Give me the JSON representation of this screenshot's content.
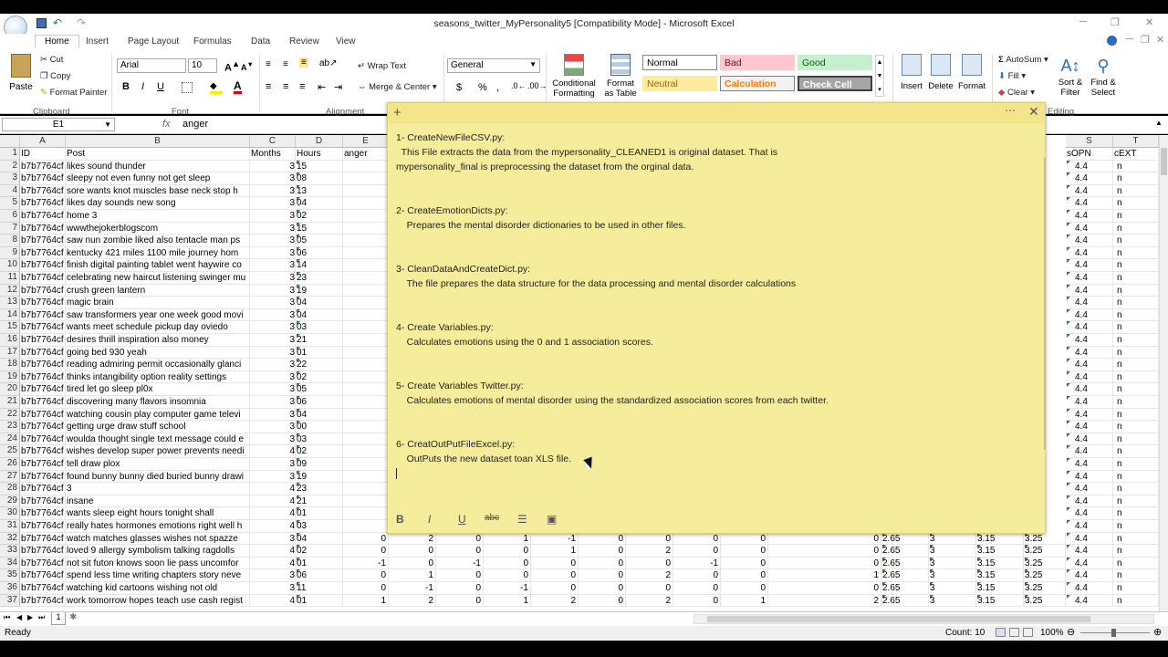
{
  "window": {
    "title": "seasons_twitter_MyPersonality5  [Compatibility Mode] - Microsoft Excel"
  },
  "ribbon_tabs": [
    "Home",
    "Insert",
    "Page Layout",
    "Formulas",
    "Data",
    "Review",
    "View"
  ],
  "ribbon": {
    "clipboard": {
      "paste": "Paste",
      "cut": "Cut",
      "copy": "Copy",
      "format_painter": "Format Painter",
      "group": "Clipboard"
    },
    "font": {
      "name": "Arial",
      "size": "10",
      "bold": "B",
      "italic": "I",
      "underline": "U",
      "group": "Font"
    },
    "alignment": {
      "wrap_text": "Wrap Text",
      "merge_center": "Merge & Center",
      "group": "Alignment"
    },
    "number": {
      "format": "General",
      "currency": "$",
      "percent": "%",
      "comma": ","
    },
    "styles": {
      "conditional": [
        "Conditional",
        "Formatting"
      ],
      "format_table": [
        "Format",
        "as Table"
      ],
      "normal": "Normal",
      "bad": "Bad",
      "good": "Good",
      "neutral": "Neutral",
      "calculation": "Calculation",
      "check_cell": "Check Cell"
    },
    "cells": {
      "insert": "Insert",
      "delete": "Delete",
      "format": "Format"
    },
    "editing": {
      "autosum": "AutoSum",
      "fill": "Fill",
      "clear": "Clear",
      "sort_filter": [
        "Sort &",
        "Filter"
      ],
      "find_select": [
        "Find &",
        "Select"
      ],
      "group": "Editing"
    }
  },
  "formula_bar": {
    "name_box": "E1",
    "fx": "fx",
    "content": "anger"
  },
  "columns": {
    "left": [
      "A",
      "B",
      "C",
      "D",
      "E"
    ],
    "right": [
      "S",
      "T"
    ]
  },
  "header_row": {
    "row": "1",
    "a": "ID",
    "b": "Post",
    "c": "Months",
    "d": "Hours",
    "e": "anger",
    "s": "sOPN",
    "t": "cEXT"
  },
  "rows": [
    {
      "n": "2",
      "a": "b7b7764cf",
      "b": "likes sound thunder",
      "c": "3",
      "d": "15",
      "s": "4.4",
      "t": "n"
    },
    {
      "n": "3",
      "a": "b7b7764cf",
      "b": "sleepy not even funny not get sleep",
      "c": "3",
      "d": "08",
      "s": "4.4",
      "t": "n"
    },
    {
      "n": "4",
      "a": "b7b7764cf",
      "b": "sore wants knot muscles base neck stop h",
      "c": "3",
      "d": "13",
      "s": "4.4",
      "t": "n"
    },
    {
      "n": "5",
      "a": "b7b7764cf",
      "b": "likes day sounds new song",
      "c": "3",
      "d": "04",
      "s": "4.4",
      "t": "n"
    },
    {
      "n": "6",
      "a": "b7b7764cf",
      "b": "home 3",
      "c": "3",
      "d": "02",
      "s": "4.4",
      "t": "n"
    },
    {
      "n": "7",
      "a": "b7b7764cf",
      "b": "wwwthejokerblogscom",
      "c": "3",
      "d": "15",
      "s": "4.4",
      "t": "n"
    },
    {
      "n": "8",
      "a": "b7b7764cf",
      "b": "saw nun zombie liked also tentacle man ps",
      "c": "3",
      "d": "05",
      "s": "4.4",
      "t": "n"
    },
    {
      "n": "9",
      "a": "b7b7764cf",
      "b": "kentucky 421 miles 1100 mile journey hom",
      "c": "3",
      "d": "06",
      "s": "4.4",
      "t": "n"
    },
    {
      "n": "10",
      "a": "b7b7764cf",
      "b": "finish digital painting tablet went haywire co",
      "c": "3",
      "d": "14",
      "s": "4.4",
      "t": "n"
    },
    {
      "n": "11",
      "a": "b7b7764cf",
      "b": "celebrating new haircut listening swinger mu",
      "c": "3",
      "d": "23",
      "s": "4.4",
      "t": "n"
    },
    {
      "n": "12",
      "a": "b7b7764cf",
      "b": "crush green lantern",
      "c": "3",
      "d": "19",
      "s": "4.4",
      "t": "n"
    },
    {
      "n": "13",
      "a": "b7b7764cf",
      "b": "magic brain",
      "c": "3",
      "d": "04",
      "s": "4.4",
      "t": "n"
    },
    {
      "n": "14",
      "a": "b7b7764cf",
      "b": "saw transformers year one week good movi",
      "c": "3",
      "d": "04",
      "s": "4.4",
      "t": "n"
    },
    {
      "n": "15",
      "a": "b7b7764cf",
      "b": "wants meet schedule pickup day oviedo",
      "c": "3",
      "d": "03",
      "s": "4.4",
      "t": "n"
    },
    {
      "n": "16",
      "a": "b7b7764cf",
      "b": "desires thrill inspiration also money",
      "c": "3",
      "d": "21",
      "s": "4.4",
      "t": "n"
    },
    {
      "n": "17",
      "a": "b7b7764cf",
      "b": "going bed 930 yeah",
      "c": "3",
      "d": "01",
      "s": "4.4",
      "t": "n"
    },
    {
      "n": "18",
      "a": "b7b7764cf",
      "b": "reading admiring permit occasionally glanci",
      "c": "3",
      "d": "22",
      "s": "4.4",
      "t": "n"
    },
    {
      "n": "19",
      "a": "b7b7764cf",
      "b": "thinks intangibility option reality settings",
      "c": "3",
      "d": "02",
      "s": "4.4",
      "t": "n"
    },
    {
      "n": "20",
      "a": "b7b7764cf",
      "b": "tired let go sleep pl0x",
      "c": "3",
      "d": "05",
      "s": "4.4",
      "t": "n"
    },
    {
      "n": "21",
      "a": "b7b7764cf",
      "b": "discovering many flavors insomnia",
      "c": "3",
      "d": "06",
      "s": "4.4",
      "t": "n"
    },
    {
      "n": "22",
      "a": "b7b7764cf",
      "b": "watching cousin play computer game televi",
      "c": "3",
      "d": "04",
      "s": "4.4",
      "t": "n"
    },
    {
      "n": "23",
      "a": "b7b7764cf",
      "b": "getting urge draw stuff school",
      "c": "3",
      "d": "00",
      "s": "4.4",
      "t": "n"
    },
    {
      "n": "24",
      "a": "b7b7764cf",
      "b": "woulda thought single text message could e",
      "c": "3",
      "d": "03",
      "s": "4.4",
      "t": "n"
    },
    {
      "n": "25",
      "a": "b7b7764cf",
      "b": "wishes develop super power prevents needi",
      "c": "4",
      "d": "02",
      "s": "4.4",
      "t": "n"
    },
    {
      "n": "26",
      "a": "b7b7764cf",
      "b": "tell draw plox",
      "c": "3",
      "d": "09",
      "s": "4.4",
      "t": "n"
    },
    {
      "n": "27",
      "a": "b7b7764cf",
      "b": "found bunny bunny died buried bunny drawi",
      "c": "3",
      "d": "19",
      "s": "4.4",
      "t": "n"
    },
    {
      "n": "28",
      "a": "b7b7764cf",
      "b": "3",
      "c": "4",
      "d": "23",
      "s": "4.4",
      "t": "n"
    },
    {
      "n": "29",
      "a": "b7b7764cf",
      "b": "insane",
      "c": "4",
      "d": "21",
      "s": "4.4",
      "t": "n"
    },
    {
      "n": "30",
      "a": "b7b7764cf",
      "b": "wants sleep eight hours tonight shall",
      "c": "4",
      "d": "01",
      "s": "4.4",
      "t": "n"
    },
    {
      "n": "31",
      "a": "b7b7764cf",
      "b": "really hates hormones emotions right well h",
      "c": "4",
      "d": "03",
      "s": "4.4",
      "t": "n"
    },
    {
      "n": "32",
      "a": "b7b7764cf",
      "b": "watch matches glasses wishes not spazze",
      "c": "3",
      "d": "04",
      "e": "0",
      "s": "4.4",
      "t": "n"
    },
    {
      "n": "33",
      "a": "b7b7764cf",
      "b": "loved 9 allergy symbolism talking ragdolls",
      "c": "4",
      "d": "02",
      "e": "0",
      "s": "4.4",
      "t": "n"
    },
    {
      "n": "34",
      "a": "b7b7764cf",
      "b": "not sit futon knows soon lie pass uncomfor",
      "c": "4",
      "d": "01",
      "e": "-1",
      "s": "4.4",
      "t": "n"
    },
    {
      "n": "35",
      "a": "b7b7764cf",
      "b": "spend less time writing chapters story neve",
      "c": "3",
      "d": "06",
      "e": "0",
      "s": "4.4",
      "t": "n"
    },
    {
      "n": "36",
      "a": "b7b7764cf",
      "b": "watching kid cartoons wishing not old",
      "c": "3",
      "d": "11",
      "e": "0",
      "s": "4.4",
      "t": "n"
    },
    {
      "n": "37",
      "a": "b7b7764cf",
      "b": "work tomorrow hopes teach use cash regist",
      "c": "4",
      "d": "01",
      "e": "1",
      "s": "4.4",
      "t": "n"
    }
  ],
  "hidden_columns_values": [
    {
      "n": "32",
      "v": [
        "2",
        "0",
        "1",
        "-1",
        "0",
        "0",
        "0",
        "0",
        "0",
        "2.65",
        "3",
        "3.15",
        "3.25"
      ]
    },
    {
      "n": "33",
      "v": [
        "0",
        "0",
        "0",
        "1",
        "0",
        "2",
        "0",
        "0",
        "0",
        "2.65",
        "3",
        "3.15",
        "3.25"
      ]
    },
    {
      "n": "34",
      "v": [
        "0",
        "-1",
        "0",
        "0",
        "0",
        "0",
        "-1",
        "0",
        "0",
        "2.65",
        "3",
        "3.15",
        "3.25"
      ]
    },
    {
      "n": "35",
      "v": [
        "1",
        "0",
        "0",
        "0",
        "0",
        "2",
        "0",
        "0",
        "1",
        "2.65",
        "3",
        "3.15",
        "3.25"
      ]
    },
    {
      "n": "36",
      "v": [
        "-1",
        "0",
        "-1",
        "0",
        "0",
        "0",
        "0",
        "0",
        "0",
        "2.65",
        "3",
        "3.15",
        "3.25"
      ]
    },
    {
      "n": "37",
      "v": [
        "2",
        "0",
        "1",
        "2",
        "0",
        "2",
        "0",
        "1",
        "2",
        "2.65",
        "3",
        "3.15",
        "3.25"
      ]
    }
  ],
  "note": {
    "text": "1- CreateNewFileCSV.py:\n  This File extracts the data from the mypersonality_CLEANED1 is original dataset. That is\nmypersonality_final is preprocessing the dataset from the orginal data.\n\n\n2- CreateEmotionDicts.py:\n    Prepares the mental disorder dictionaries to be used in other files.\n\n\n3- CleanDataAndCreateDict.py:\n    The file prepares the data structure for the data processing and mental disorder calculations\n\n\n4- Create Variables.py:\n    Calculates emotions using the 0 and 1 association scores.\n\n\n5- Create Variables Twitter.py:\n    Calculates emotions of mental disorder using the standardized association scores from each twitter.\n\n\n6- CreatOutPutFileExcel.py:\n    OutPuts the new dataset toan XLS file.",
    "toolbar": {
      "bold": "B",
      "italic": "I",
      "underline": "U",
      "strike": "abc"
    }
  },
  "sheet_tab": "1",
  "status": {
    "ready": "Ready",
    "count": "Count: 10",
    "zoom": "100%"
  }
}
